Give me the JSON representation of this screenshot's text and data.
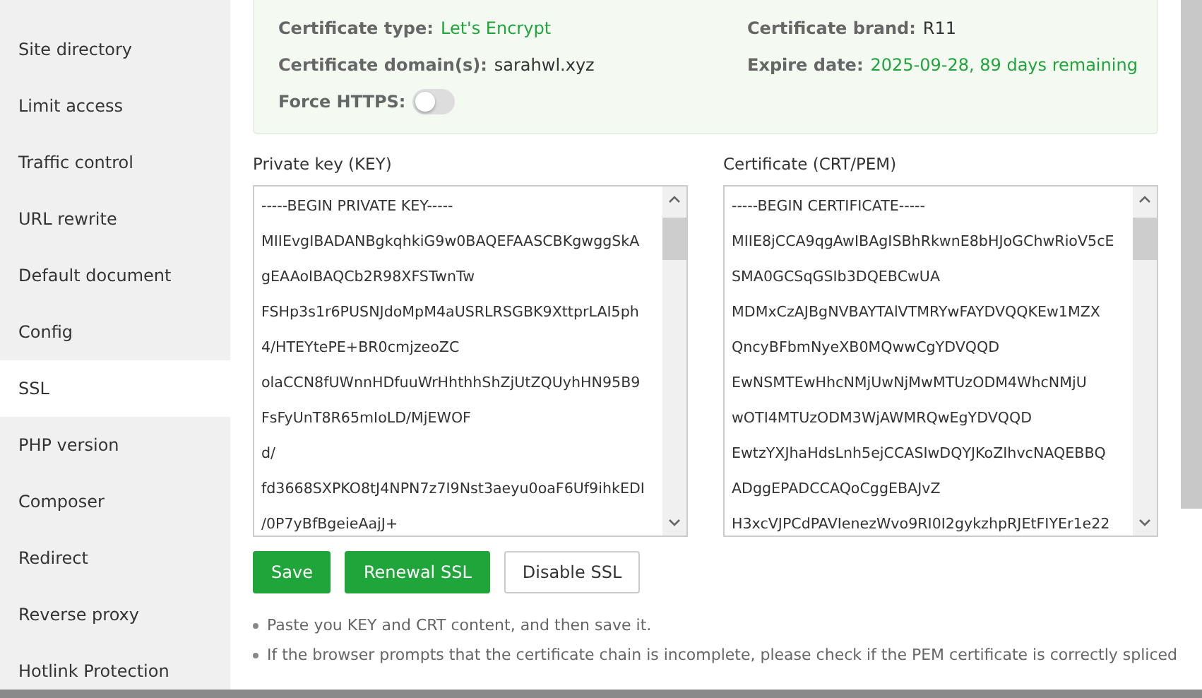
{
  "sidebar": {
    "items": [
      {
        "label": "Site directory",
        "selected": false
      },
      {
        "label": "Limit access",
        "selected": false
      },
      {
        "label": "Traffic control",
        "selected": false
      },
      {
        "label": "URL rewrite",
        "selected": false
      },
      {
        "label": "Default document",
        "selected": false
      },
      {
        "label": "Config",
        "selected": false
      },
      {
        "label": "SSL",
        "selected": true
      },
      {
        "label": "PHP version",
        "selected": false
      },
      {
        "label": "Composer",
        "selected": false
      },
      {
        "label": "Redirect",
        "selected": false
      },
      {
        "label": "Reverse proxy",
        "selected": false
      },
      {
        "label": "Hotlink Protection",
        "selected": false
      }
    ]
  },
  "certificate_info": {
    "fields": [
      {
        "label": "Certificate type:",
        "value": "Let's Encrypt",
        "highlight": true
      },
      {
        "label": "Certificate brand:",
        "value": "R11",
        "highlight": false
      },
      {
        "label": "Certificate domain(s):",
        "value": "sarahwl.xyz",
        "highlight": false
      },
      {
        "label": "Expire date:",
        "value": "2025-09-28, 89 days remaining",
        "highlight": true
      }
    ],
    "force_https": {
      "label": "Force HTTPS:",
      "on": false
    }
  },
  "editors": [
    {
      "label": "Private key (KEY)",
      "lines": [
        "-----BEGIN PRIVATE KEY-----",
        "MIIEvgIBADANBgkqhkiG9w0BAQEFAASCBKgwggSkA",
        "gEAAoIBAQCb2R98XFSTwnTw",
        "FSHp3s1r6PUSNJdoMpM4aUSRLRSGBK9XttprLAI5ph",
        "4/HTEYtePE+BR0cmjzeoZC",
        "olaCCN8fUWnnHDfuuWrHhthhShZjUtZQUyhHN95B9",
        "FsFyUnT8R65mIoLD/MjEWOF",
        "d/",
        "fd3668SXPKO8tJ4NPN7z7I9Nst3aeyu0oaF6Uf9ihkEDI",
        "/0P7yBfBgeieAajJ+"
      ]
    },
    {
      "label": "Certificate (CRT/PEM)",
      "lines": [
        "-----BEGIN CERTIFICATE-----",
        "MIIE8jCCA9qgAwIBAgISBhRkwnE8bHJoGChwRioV5cE",
        "SMA0GCSqGSIb3DQEBCwUA",
        "MDMxCzAJBgNVBAYTAlVTMRYwFAYDVQQKEw1MZX",
        "QncyBFbmNyeXB0MQwwCgYDVQQD",
        "EwNSMTEwHhcNMjUwNjMwMTUzODM4WhcNMjU",
        "wOTI4MTUzODM3WjAWMRQwEgYDVQQD",
        "EwtzYXJhaHdsLnh5ejCCASIwDQYJKoZIhvcNAQEBBQ",
        "ADggEPADCCAQoCggEBAJvZ",
        "H3xcVJPCdPAVIenezWvo9RI0I2gykzhpRJEtFIYEr1e22"
      ]
    }
  ],
  "buttons": [
    {
      "label": "Save",
      "kind": "primary"
    },
    {
      "label": "Renewal SSL",
      "kind": "primary"
    },
    {
      "label": "Disable SSL",
      "kind": "default"
    }
  ],
  "notes": [
    "Paste you KEY and CRT content, and then save it.",
    "If the browser prompts that the certificate chain is incomplete, please check if the PEM certificate is correctly spliced"
  ]
}
